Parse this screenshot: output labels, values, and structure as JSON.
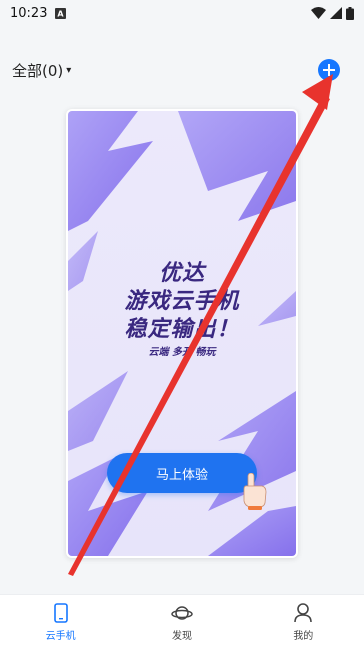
{
  "status_bar": {
    "time": "10:23",
    "notif_icon": "a-letter-icon",
    "icons": [
      "wifi-icon",
      "signal-icon",
      "battery-icon"
    ]
  },
  "header": {
    "filter_label": "全部(0)",
    "filter_caret": "▾",
    "add_icon": "plus-circle-icon"
  },
  "promo": {
    "title_line1": "优达",
    "title_line2": "游戏云手机",
    "title_line3": "稳定输出！",
    "subtitle": "云端 多开 畅玩",
    "button_label": "马上体验"
  },
  "tabbar": {
    "items": [
      {
        "label": "云手机",
        "icon": "phone-icon",
        "active": true
      },
      {
        "label": "发现",
        "icon": "planet-icon",
        "active": false
      },
      {
        "label": "我的",
        "icon": "person-icon",
        "active": false
      }
    ]
  },
  "colors": {
    "accent": "#1677ff",
    "arrow": "#e8332d",
    "promo_purple": "#8f7cf0"
  }
}
